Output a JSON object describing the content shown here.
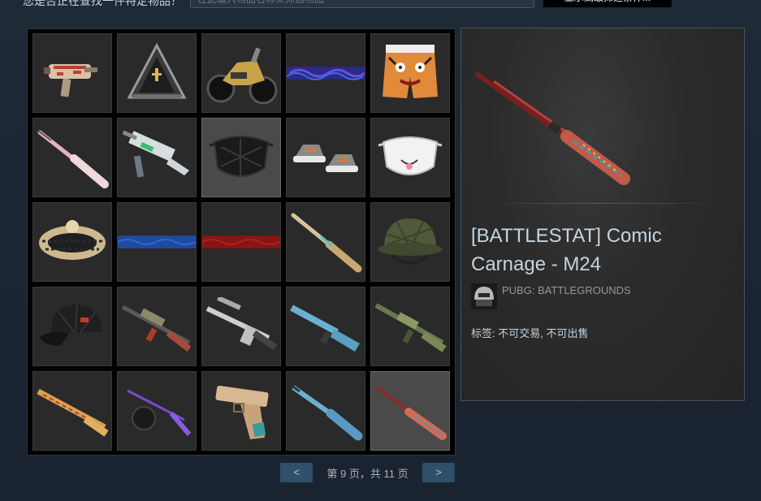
{
  "filter": {
    "label": "您是否正在查找一件特定物品？",
    "placeholder": "在此输入物品名称来筛选物品",
    "action_label": "显示高级筛选条件..."
  },
  "inventory": {
    "items": [
      {
        "name": "smg-graffiti-skin",
        "icon": "uzi-icon"
      },
      {
        "name": "crate-pyramid",
        "icon": "crate-icon"
      },
      {
        "name": "motorbike-gold",
        "icon": "motorbike-icon"
      },
      {
        "name": "bandana-purple",
        "icon": "bandana-icon"
      },
      {
        "name": "tiger-shorts",
        "icon": "shorts-icon"
      },
      {
        "name": "rifle-pink",
        "icon": "rifle-icon"
      },
      {
        "name": "ump-white-green",
        "icon": "smg-icon"
      },
      {
        "name": "black-face-mask",
        "icon": "mask-icon",
        "selected": true
      },
      {
        "name": "sneakers-orange",
        "icon": "shoes-icon"
      },
      {
        "name": "white-face-mask",
        "icon": "mask-icon"
      },
      {
        "name": "wreath-headband",
        "icon": "headband-icon"
      },
      {
        "name": "bandana-blue",
        "icon": "bandana-icon"
      },
      {
        "name": "bandana-red",
        "icon": "bandana-icon"
      },
      {
        "name": "rifle-tan",
        "icon": "rifle-icon"
      },
      {
        "name": "army-helmet",
        "icon": "helmet-icon"
      },
      {
        "name": "black-cap",
        "icon": "cap-icon"
      },
      {
        "name": "assault-rifle-red",
        "icon": "assault-rifle-icon"
      },
      {
        "name": "shotgun-white",
        "icon": "shotgun-icon"
      },
      {
        "name": "vss-blue",
        "icon": "sniper-icon"
      },
      {
        "name": "assault-rifle-green",
        "icon": "assault-rifle-icon"
      },
      {
        "name": "rifle-graffiti",
        "icon": "assault-rifle-icon"
      },
      {
        "name": "smg-purple",
        "icon": "smg-icon"
      },
      {
        "name": "pistol-tan",
        "icon": "pistol-icon"
      },
      {
        "name": "shotgun-blue",
        "icon": "shotgun-icon"
      },
      {
        "name": "m24-comic-carnage",
        "icon": "rifle-icon",
        "selected": true
      }
    ]
  },
  "pager": {
    "prev": "<",
    "next": ">",
    "text": "第 9 页，共 11 页"
  },
  "detail": {
    "title": "[BATTLESTAT] Comic Carnage - M24",
    "game": "PUBG: BATTLEGROUNDS",
    "tags": "标签: 不可交易, 不可出售"
  },
  "colors": {
    "page_bg": "#1b2838",
    "accent_blue": "#2f4f6b",
    "panel_border": "#4d5257"
  }
}
